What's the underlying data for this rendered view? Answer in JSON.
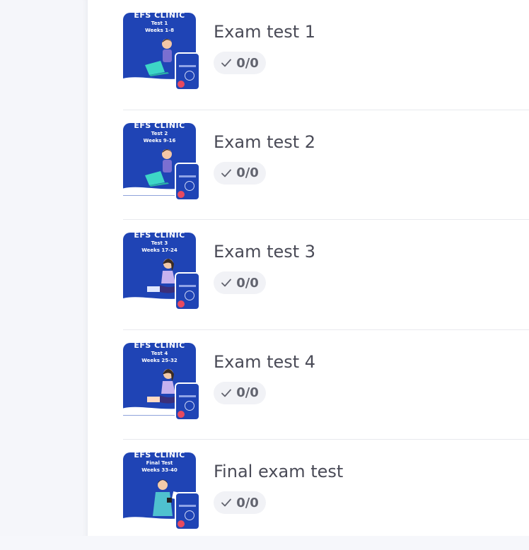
{
  "courses": [
    {
      "title": "Exam test 1",
      "progress": "0/0",
      "cover_brand": "EFS CLINIC",
      "cover_test": "Test 1",
      "cover_weeks": "Weeks 1-8"
    },
    {
      "title": "Exam test 2",
      "progress": "0/0",
      "cover_brand": "EFS CLINIC",
      "cover_test": "Test 2",
      "cover_weeks": "Weeks 9-16"
    },
    {
      "title": "Exam test 3",
      "progress": "0/0",
      "cover_brand": "EFS CLINIC",
      "cover_test": "Test 3",
      "cover_weeks": "Weeks 17-24"
    },
    {
      "title": "Exam test 4",
      "progress": "0/0",
      "cover_brand": "EFS CLINIC",
      "cover_test": "Test 4",
      "cover_weeks": "Weeks 25-32"
    },
    {
      "title": "Final exam test",
      "progress": "0/0",
      "cover_brand": "EFS CLINIC",
      "cover_test": "Final Test",
      "cover_weeks": "Weeks 33-40"
    }
  ],
  "colors": {
    "cover_blue": "#1f44b5",
    "title_text": "#4a4b57",
    "badge_bg": "#f1f2f6"
  },
  "icons": {
    "progress": "check-icon",
    "figure": "person-laptop-icon"
  }
}
